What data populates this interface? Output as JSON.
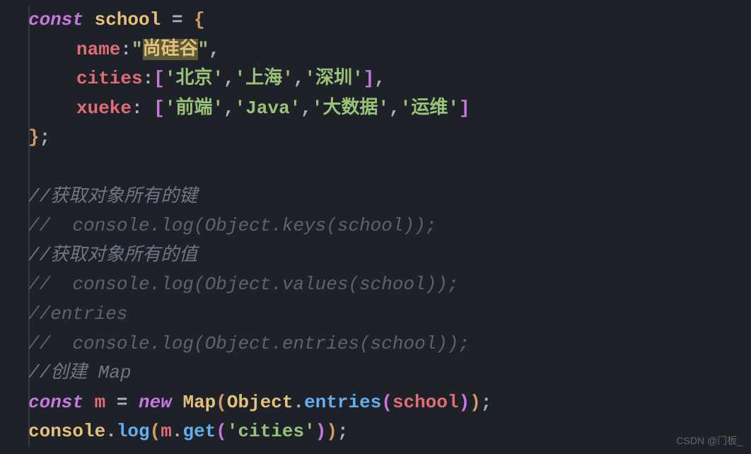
{
  "code": {
    "line1": {
      "kw": "const",
      "var": "school",
      "eq": " = ",
      "brace": "{"
    },
    "line2": {
      "prop": "name",
      "colon": ":",
      "q1": "\"",
      "val": "尚硅谷",
      "q2": "\"",
      "comma": ","
    },
    "line3": {
      "prop": "cities",
      "colon": ":",
      "open": "[",
      "v1": "'北京'",
      "c1": ",",
      "v2": "'上海'",
      "c2": ",",
      "v3": "'深圳'",
      "close": "]",
      "comma": ","
    },
    "line4": {
      "prop": "xueke",
      "colon": ": ",
      "open": "[",
      "v1": "'前端'",
      "c1": ",",
      "v2": "'Java'",
      "c2": ",",
      "v3": "'大数据'",
      "c3": ",",
      "v4": "'运维'",
      "close": "]"
    },
    "line5": {
      "brace": "}",
      "semi": ";"
    },
    "line7": "//获取对象所有的键",
    "line8": "//  console.log(Object.keys(school));",
    "line9": "//获取对象所有的值",
    "line10": "//  console.log(Object.values(school));",
    "line11": "//entries",
    "line12": "//  console.log(Object.entries(school));",
    "line13": "//创建 Map",
    "line14": {
      "kw": "const",
      "var": "m",
      "eq": " = ",
      "new": "new",
      "class": "Map",
      "p1": "(",
      "obj": "Object",
      "dot": ".",
      "method": "entries",
      "p2": "(",
      "arg": "school",
      "p3": ")",
      "p4": ")",
      "semi": ";"
    },
    "line15": {
      "obj": "console",
      "dot": ".",
      "method": "log",
      "p1": "(",
      "var": "m",
      "dot2": ".",
      "get": "get",
      "p2": "(",
      "str": "'cities'",
      "p3": ")",
      "p4": ")",
      "semi": ";"
    }
  },
  "watermark": "CSDN @门板_"
}
